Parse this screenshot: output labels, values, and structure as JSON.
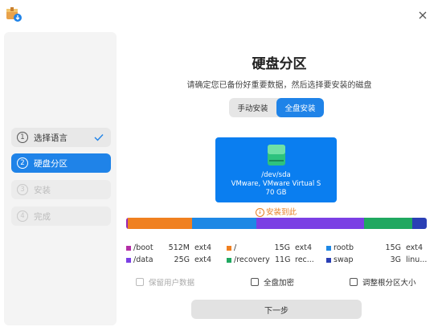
{
  "window": {
    "app_icon": "installer-box-icon",
    "close_icon": "close-icon"
  },
  "sidebar": {
    "steps": [
      {
        "num": "1",
        "label": "选择语言",
        "state": "done"
      },
      {
        "num": "2",
        "label": "硬盘分区",
        "state": "active"
      },
      {
        "num": "3",
        "label": "安装",
        "state": "disabled"
      },
      {
        "num": "4",
        "label": "完成",
        "state": "disabled"
      }
    ]
  },
  "main": {
    "title": "硬盘分区",
    "subtitle": "请确定您已备份好重要数据，然后选择要安装的磁盘",
    "tabs": [
      {
        "label": "手动安装",
        "selected": false
      },
      {
        "label": "全盘安装",
        "selected": true
      }
    ],
    "disk": {
      "icon": "hard-disk-icon",
      "device": "/dev/sda",
      "model": "VMware, VMware Virtual S",
      "size": "70 GB"
    },
    "install_target": "安装到此",
    "partition_bar": [
      {
        "color": "#9b27af",
        "fraction": 0.006
      },
      {
        "color": "#f08020",
        "fraction": 0.213
      },
      {
        "color": "#1e88e5",
        "fraction": 0.213
      },
      {
        "color": "#7b3fe4",
        "fraction": 0.36
      },
      {
        "color": "#20a860",
        "fraction": 0.16
      },
      {
        "color": "#2a3fb5",
        "fraction": 0.048
      }
    ],
    "partitions": [
      {
        "name": "/boot",
        "size": "512M",
        "fs": "ext4",
        "color": "#b32ea6"
      },
      {
        "name": "/",
        "size": "15G",
        "fs": "ext4",
        "color": "#f08020"
      },
      {
        "name": "rootb",
        "size": "15G",
        "fs": "ext4",
        "color": "#1e88e5"
      },
      {
        "name": "/data",
        "size": "25G",
        "fs": "ext4",
        "color": "#7b3fe4"
      },
      {
        "name": "/recovery",
        "size": "11G",
        "fs": "rec...",
        "color": "#20a860"
      },
      {
        "name": "swap",
        "size": "3G",
        "fs": "linu...",
        "color": "#2a3fb5"
      }
    ],
    "options": [
      {
        "label": "保留用户数据",
        "enabled": false,
        "checked": false
      },
      {
        "label": "全盘加密",
        "enabled": true,
        "checked": false
      },
      {
        "label": "调整根分区大小",
        "enabled": true,
        "checked": false
      }
    ],
    "next_label": "下一步"
  }
}
